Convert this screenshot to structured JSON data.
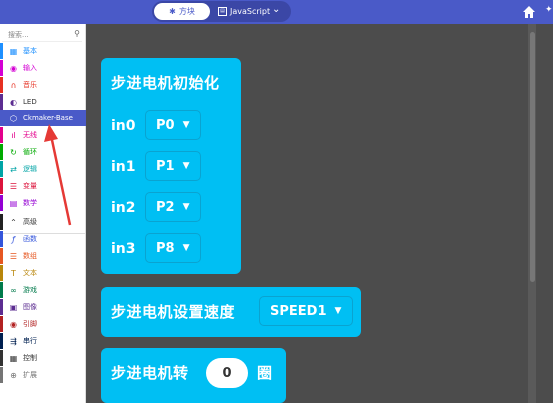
{
  "topbar": {
    "tabs": [
      {
        "label": "方块",
        "icon": "puzzle-icon",
        "active": true
      },
      {
        "label": "JavaScript",
        "icon": "code-icon",
        "active": false
      }
    ],
    "home_icon": "home-icon"
  },
  "sidebar": {
    "search_placeholder": "搜索...",
    "categories": [
      {
        "label": "基本",
        "color": "#1e90ff",
        "icon": "grid-icon"
      },
      {
        "label": "输入",
        "color": "#d400d4",
        "icon": "input-icon"
      },
      {
        "label": "音乐",
        "color": "#e63022",
        "icon": "headphones-icon"
      },
      {
        "label": "LED",
        "color": "#5c2d91",
        "icon": "toggle-icon"
      },
      {
        "label": "Ckmaker-Base",
        "color": "#ffffff",
        "icon": "cube-icon",
        "active": true
      },
      {
        "label": "无线",
        "color": "#e3008c",
        "icon": "signal-icon"
      },
      {
        "label": "循环",
        "color": "#00aa00",
        "icon": "refresh-icon"
      },
      {
        "label": "逻辑",
        "color": "#00a4a6",
        "icon": "shuffle-icon"
      },
      {
        "label": "变量",
        "color": "#dc143c",
        "icon": "list-icon"
      },
      {
        "label": "数学",
        "color": "#9400d3",
        "icon": "calculator-icon"
      },
      {
        "label": "高级",
        "color": "#333333",
        "icon": "chevron-up-icon"
      },
      {
        "label": "函数",
        "color": "#3455db",
        "icon": "function-icon"
      },
      {
        "label": "数组",
        "color": "#e65722",
        "icon": "array-icon"
      },
      {
        "label": "文本",
        "color": "#b8860b",
        "icon": "text-icon"
      },
      {
        "label": "游戏",
        "color": "#007a4b",
        "icon": "game-icon"
      },
      {
        "label": "图像",
        "color": "#5c2d91",
        "icon": "image-icon"
      },
      {
        "label": "引脚",
        "color": "#b22222",
        "icon": "pin-icon"
      },
      {
        "label": "串行",
        "color": "#002050",
        "icon": "usb-icon"
      },
      {
        "label": "控制",
        "color": "#333333",
        "icon": "control-icon"
      },
      {
        "label": "扩展",
        "color": "#757575",
        "icon": "plus-icon"
      }
    ]
  },
  "workspace": {
    "init_block": {
      "title": "步进电机初始化",
      "pins": [
        {
          "label": "in0",
          "value": "P0"
        },
        {
          "label": "in1",
          "value": "P1"
        },
        {
          "label": "in2",
          "value": "P2"
        },
        {
          "label": "in3",
          "value": "P8"
        }
      ]
    },
    "speed_block": {
      "title": "步进电机设置速度",
      "value": "SPEED1"
    },
    "turn_block": {
      "title": "步进电机转",
      "value": "0",
      "suffix": "圈"
    }
  },
  "colors": {
    "topbar": "#4a5ac8",
    "block": "#00bff3",
    "workspace": "#4c4c4c",
    "arrow": "#e53935"
  }
}
